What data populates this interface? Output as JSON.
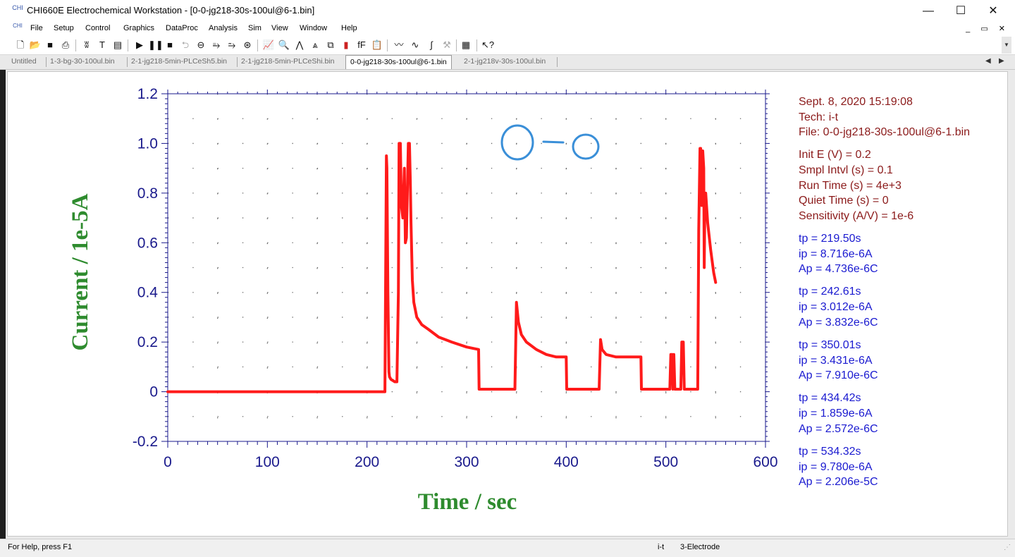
{
  "window": {
    "title": "CHI660E Electrochemical Workstation - [0-0-jg218-30s-100ul@6-1.bin]",
    "app_icon_label": "CHI",
    "controls": [
      "—",
      "☐",
      "✕"
    ]
  },
  "menu": [
    "File",
    "Setup",
    "Control",
    "Graphics",
    "DataProc",
    "Analysis",
    "Sim",
    "View",
    "Window",
    "Help"
  ],
  "toolbar_icons": [
    "new-file-icon",
    "open-icon",
    "save-icon",
    "print-icon",
    "technique-icon",
    "text-icon",
    "parameter-icon",
    "run-icon",
    "pause-icon",
    "stop-icon",
    "reverse-icon",
    "ir-comp-icon",
    "filter-icon",
    "cell-icon",
    "rotate-icon",
    "graph-icon",
    "zoom-icon",
    "peak-icon",
    "overlay-icon",
    "copy-graph-icon",
    "color-icon",
    "font-icon",
    "clipboard-icon",
    "smooth-icon",
    "derivative-icon",
    "integrate-icon",
    "hammer-icon",
    "data-list-icon",
    "help-icon"
  ],
  "tabs": [
    {
      "label": "Untitled",
      "active": false
    },
    {
      "label": "1-3-bg-30-100ul.bin",
      "active": false
    },
    {
      "label": "2-1-jg218-5min-PLCeSh5.bin",
      "active": false
    },
    {
      "label": "2-1-jg218-5min-PLCeShi.bin",
      "active": false
    },
    {
      "label": "0-0-jg218-30s-100ul@6-1.bin",
      "active": true
    },
    {
      "label": "2-1-jg218v-30s-100ul.bin",
      "active": false
    }
  ],
  "annotation": {
    "header": [
      "Sept. 8, 2020   15:19:08",
      "Tech: i-t",
      "File: 0-0-jg218-30s-100ul@6-1.bin"
    ],
    "params": [
      "Init E (V) = 0.2",
      "Smpl Intvl (s) = 0.1",
      "Run Time (s) = 4e+3",
      "Quiet Time (s) = 0",
      "Sensitivity (A/V) = 1e-6"
    ],
    "peaks": [
      {
        "tp": "tp = 219.50s",
        "ip": "ip = 8.716e-6A",
        "ap": "Ap = 4.736e-6C"
      },
      {
        "tp": "tp = 242.61s",
        "ip": "ip = 3.012e-6A",
        "ap": "Ap = 3.832e-6C"
      },
      {
        "tp": "tp = 350.01s",
        "ip": "ip = 3.431e-6A",
        "ap": "Ap = 7.910e-6C"
      },
      {
        "tp": "tp = 434.42s",
        "ip": "ip = 1.859e-6A",
        "ap": "Ap = 2.572e-6C"
      },
      {
        "tp": "tp = 534.32s",
        "ip": "ip = 9.780e-6A",
        "ap": "Ap = 2.206e-5C"
      }
    ]
  },
  "handwriting": "0-0",
  "status": {
    "help": "For Help, press F1",
    "tech": "i-t",
    "electrode": "3-Electrode"
  },
  "colors": {
    "trace": "#ff1a1a",
    "baseline_trace": "#44aacc",
    "axis_text": "#1a1a8c",
    "axis_title": "#2e8b2e",
    "annotation_dark": "#8b1a1a",
    "annotation_blue": "#1a1ad0",
    "handwriting": "#3a8fd8"
  },
  "chart_data": {
    "type": "line",
    "xlabel": "Time / sec",
    "ylabel": "Current / 1e-5A",
    "xlim": [
      0,
      600
    ],
    "ylim": [
      -0.2,
      1.2
    ],
    "xticks": [
      0,
      100,
      200,
      300,
      400,
      500,
      600
    ],
    "yticks": [
      -0.2,
      0,
      0.2,
      0.4,
      0.6,
      0.8,
      1.0,
      1.2
    ],
    "ytick_labels": [
      "-0.2",
      "0",
      "0.2",
      "0.4",
      "0.6",
      "0.8",
      "1.0",
      "1.2"
    ],
    "grid": "dotted",
    "series": [
      {
        "x": [
          0,
          100,
          200,
          218,
          219.5,
          220,
          221,
          222,
          222.6,
          224,
          228,
          230,
          231.5,
          232.2,
          233.5,
          234.5,
          236,
          237.5,
          238.5,
          239.6,
          240.5,
          241.5,
          242.6,
          243.5,
          244.2,
          245.5,
          247,
          250,
          255,
          262,
          272,
          285,
          300,
          312,
          312.5,
          330,
          348.5,
          350,
          352,
          355,
          360,
          370,
          380,
          390,
          400,
          400.5,
          420,
          433,
          434.4,
          436,
          440,
          450,
          460,
          475,
          475.5,
          500,
          504,
          505,
          506.5,
          507,
          508,
          509,
          515,
          516,
          517.5,
          518.5,
          520,
          530,
          532,
          533,
          534.3,
          535,
          536,
          537,
          538,
          538.5,
          539,
          540,
          542,
          545,
          548,
          550
        ],
        "y": [
          0,
          0,
          0,
          0,
          0.95,
          0.9,
          0.4,
          0.08,
          0.06,
          0.05,
          0.04,
          0.04,
          0.4,
          1.0,
          1.0,
          0.75,
          0.7,
          0.9,
          0.6,
          0.62,
          0.8,
          1.0,
          1.0,
          0.85,
          0.68,
          0.45,
          0.36,
          0.3,
          0.27,
          0.25,
          0.22,
          0.2,
          0.18,
          0.17,
          0.01,
          0.01,
          0.01,
          0.36,
          0.28,
          0.23,
          0.2,
          0.17,
          0.15,
          0.14,
          0.14,
          0.01,
          0.01,
          0.01,
          0.21,
          0.17,
          0.15,
          0.14,
          0.14,
          0.14,
          0.01,
          0.01,
          0.01,
          0.15,
          0.15,
          0.01,
          0.15,
          0.01,
          0.01,
          0.2,
          0.2,
          0.01,
          0.01,
          0.01,
          0.01,
          0.65,
          0.98,
          0.98,
          0.75,
          0.97,
          0.9,
          0.5,
          0.7,
          0.8,
          0.68,
          0.57,
          0.48,
          0.44
        ]
      }
    ]
  }
}
